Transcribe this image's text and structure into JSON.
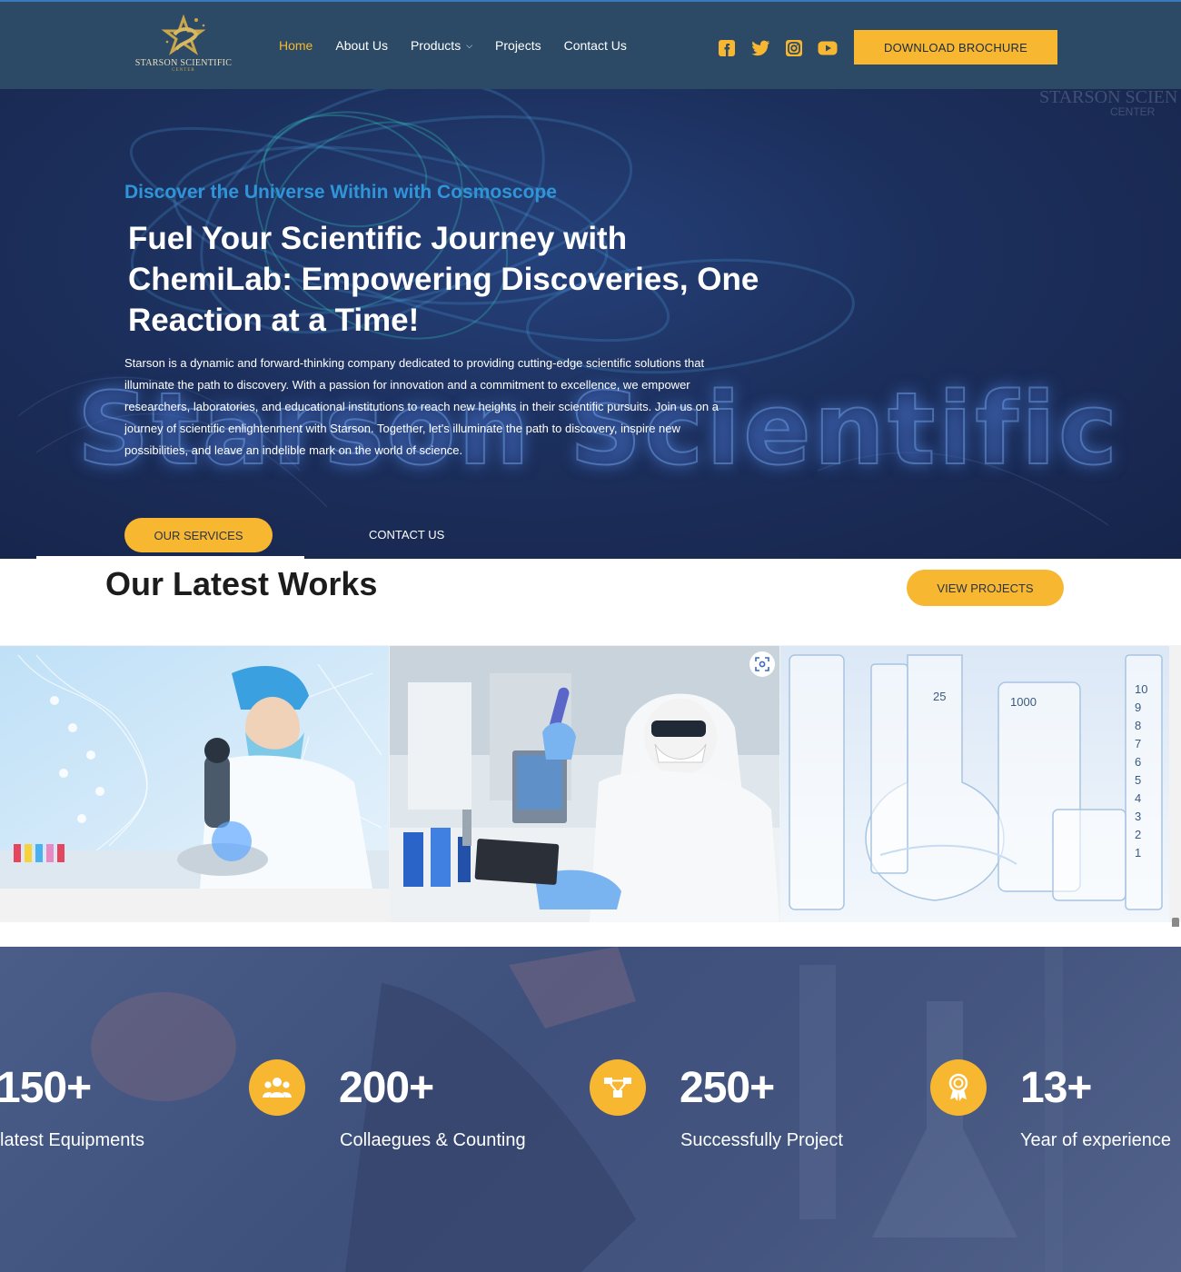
{
  "header": {
    "logo": {
      "name": "STARSON SCIENTIFIC",
      "sub": "CENTER"
    },
    "nav": [
      {
        "label": "Home",
        "active": true
      },
      {
        "label": "About Us"
      },
      {
        "label": "Products",
        "has_dropdown": true
      },
      {
        "label": "Projects"
      },
      {
        "label": "Contact Us"
      }
    ],
    "socials": [
      "facebook-icon",
      "twitter-icon",
      "instagram-icon",
      "youtube-icon"
    ],
    "cta": "DOWNLOAD BROCHURE"
  },
  "hero": {
    "kicker": "Discover the Universe Within with Cosmoscope",
    "title": "Fuel Your Scientific Journey with ChemiLab: Empowering Discoveries, One Reaction at a Time!",
    "description": "Starson is a dynamic and forward-thinking company dedicated to providing cutting-edge scientific solutions that illuminate the path to discovery. With a passion for innovation and a commitment to excellence, we empower researchers, laboratories, and educational institutions to reach new heights in their scientific pursuits. Join us on a journey of scientific enlightenment with Starson. Together, let's illuminate the path to discovery, inspire new possibilities, and leave an indelible mark on the world of science.",
    "watermark": "Starson Scientific",
    "logo_watermark": {
      "name": "STARSON SCIEN",
      "sub": "CENTER"
    },
    "primary_button": "OUR SERVICES",
    "secondary_button": "CONTACT US"
  },
  "works": {
    "title": "Our Latest Works",
    "button": "VIEW PROJECTS",
    "images": [
      {
        "name": "scientist-microscope-image"
      },
      {
        "name": "scientist-test-tube-image"
      },
      {
        "name": "lab-glassware-image"
      }
    ]
  },
  "stats": [
    {
      "number": "150+",
      "label": "latest Equipments",
      "icon": "equipment-icon"
    },
    {
      "number": "200+",
      "label": "Collaegues & Counting",
      "icon": "users-icon"
    },
    {
      "number": "250+",
      "label": "Successfully Project",
      "icon": "project-icon"
    },
    {
      "number": "13+",
      "label": "Year of experience",
      "icon": "award-icon"
    }
  ],
  "colors": {
    "accent": "#f7b731",
    "header_bg": "#2c4a66",
    "hero_bg": "#1c2f5c",
    "kicker": "#2f95d8",
    "stats_bg": "#44557f"
  }
}
